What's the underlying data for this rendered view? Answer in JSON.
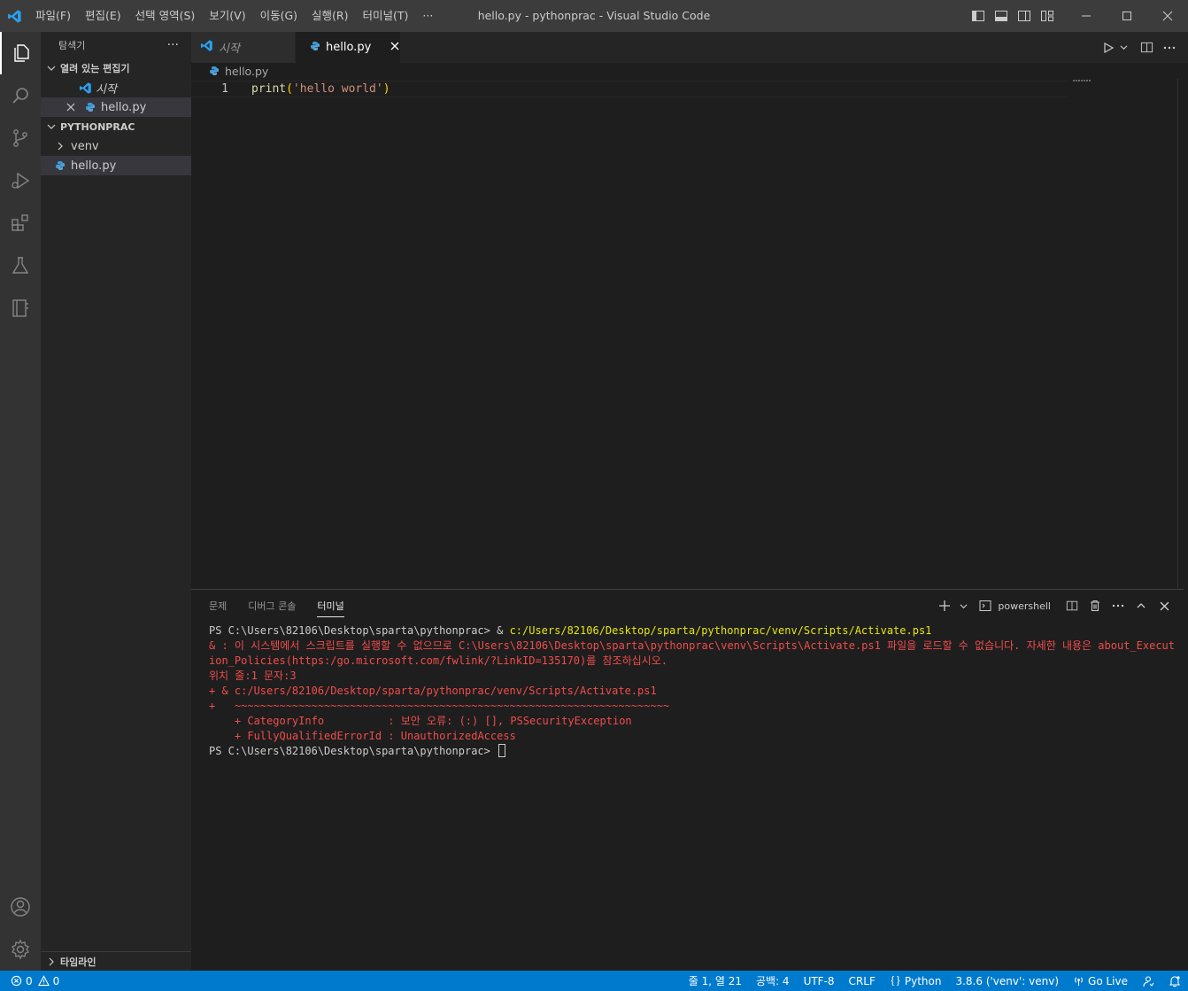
{
  "window": {
    "title": "hello.py - pythonprac - Visual Studio Code",
    "menu": [
      "파일(F)",
      "편집(E)",
      "선택 영역(S)",
      "보기(V)",
      "이동(G)",
      "실행(R)",
      "터미널(T)",
      "···"
    ]
  },
  "sidebar": {
    "title": "탐색기",
    "more": "···",
    "open_editors": {
      "label": "열려 있는 편집기",
      "items": [
        {
          "label": "시작",
          "icon": "vscode-icon"
        },
        {
          "label": "hello.py",
          "icon": "python-file-icon"
        }
      ]
    },
    "folder": {
      "label": "PYTHONPRAC",
      "items": [
        {
          "label": "venv",
          "type": "folder"
        },
        {
          "label": "hello.py",
          "type": "file"
        }
      ]
    },
    "timeline_label": "타임라인"
  },
  "tabs": [
    {
      "label": "시작",
      "active": false
    },
    {
      "label": "hello.py",
      "active": true
    }
  ],
  "breadcrumb": "hello.py",
  "editor": {
    "line_number": "1",
    "code_fn": "print",
    "code_open": "(",
    "code_str": "'hello world'",
    "code_close": ")"
  },
  "panel": {
    "tabs": [
      "문제",
      "디버그 콘솔",
      "터미널"
    ],
    "active_tab": "터미널",
    "shell_name": "powershell",
    "terminal": {
      "l1_prompt": "PS C:\\Users\\82106\\Desktop\\sparta\\pythonprac> & ",
      "l1_cmd": "c:/Users/82106/Desktop/sparta/pythonprac/venv/Scripts/Activate.ps1",
      "l2": "& : 이 시스템에서 스크립트를 실행할 수 없으므로 C:\\Users\\82106\\Desktop\\sparta\\pythonprac\\venv\\Scripts\\Activate.ps1 파일을 로드할 수 없습니다. 자세한 내용은 about_Execution_Policies(https:/go.microsoft.com/fwlink/?LinkID=135170)를 참조하십시오.",
      "l3": "위치 줄:1 문자:3",
      "l4": "+ & c:/Users/82106/Desktop/sparta/pythonprac/venv/Scripts/Activate.ps1",
      "l5": "+   ~~~~~~~~~~~~~~~~~~~~~~~~~~~~~~~~~~~~~~~~~~~~~~~~~~~~~~~~~~~~~~~~~~~~",
      "l6": "    + CategoryInfo          : 보안 오류: (:) [], PSSecurityException",
      "l7": "    + FullyQualifiedErrorId : UnauthorizedAccess",
      "l8_prompt": "PS C:\\Users\\82106\\Desktop\\sparta\\pythonprac> "
    }
  },
  "statusbar": {
    "errors": "0",
    "warnings": "0",
    "position": "줄 1, 열 21",
    "indent": "공백: 4",
    "encoding": "UTF-8",
    "eol": "CRLF",
    "language": "Python",
    "interpreter": "3.8.6 ('venv': venv)",
    "golive": "Go Live"
  },
  "colors": {
    "accent": "#007acc",
    "titlebar": "#3c3c3c",
    "activitybar": "#333333",
    "sidebar": "#252526",
    "editor": "#1e1e1e",
    "error_text": "#f14c4c",
    "command_text": "#e5e510"
  }
}
